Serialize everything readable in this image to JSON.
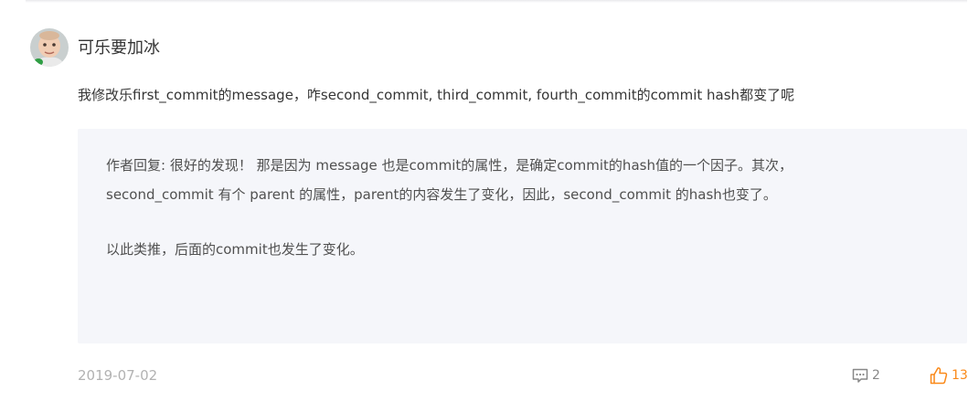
{
  "comment": {
    "username": "可乐要加冰",
    "text": "我修改乐first_commit的message，咋second_commit, third_commit, fourth_commit的commit hash都变了呢",
    "date": "2019-07-02",
    "reply_count": "2",
    "like_count": "13"
  },
  "reply": {
    "line1": "作者回复: 很好的发现！ 那是因为 message 也是commit的属性，是确定commit的hash值的一个因子。其次，",
    "line2": "second_commit 有个 parent 的属性，parent的内容发生了变化，因此，second_commit 的hash也变了。",
    "line3": "以此类推，后面的commit也发生了变化。"
  },
  "colors": {
    "reply_background": "#f5f6fa",
    "like_accent": "#fa8919",
    "date_gray": "#b2b2b2"
  },
  "icons": {
    "comment": "comment-bubble-icon",
    "like": "thumbs-up-icon"
  }
}
